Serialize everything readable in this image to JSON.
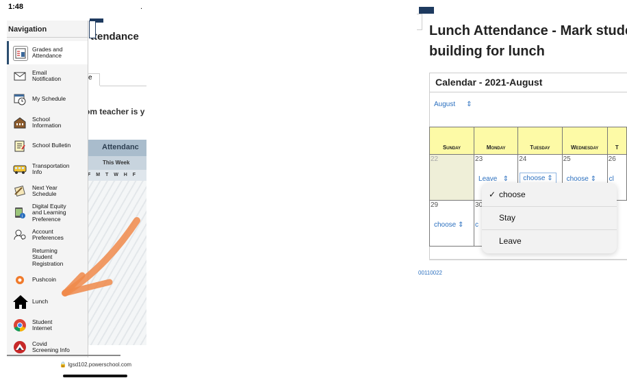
{
  "left_phone": {
    "status_time": "1:48",
    "status_dot": ".",
    "background_page": {
      "title": "ttendance",
      "tab_label": "e",
      "teacher_text": "om teacher is y",
      "table_header": "Attendanc",
      "week_label": "This Week",
      "day_letters": "F M T W H F"
    },
    "navigation": {
      "title": "Navigation",
      "items": [
        {
          "label": "Grades and\nAttendance",
          "icon": "grades-icon",
          "active": true
        },
        {
          "label": "Email\nNotification",
          "icon": "email-icon"
        },
        {
          "label": "My Schedule",
          "icon": "schedule-icon"
        },
        {
          "label": "School\nInformation",
          "icon": "school-icon"
        },
        {
          "label": "School Bulletin",
          "icon": "bulletin-icon"
        },
        {
          "label": "Transportation\nInfo",
          "icon": "bus-icon"
        },
        {
          "label": "Next Year\nSchedule",
          "icon": "next-year-icon"
        },
        {
          "label": "Digital Equity\nand Learning\nPreference",
          "icon": "digital-equity-icon"
        },
        {
          "label": "Account\nPreferences",
          "icon": "account-icon"
        },
        {
          "label": "Returning\nStudent\nRegistration",
          "icon": ""
        },
        {
          "label": "Pushcoin",
          "icon": "pushcoin-icon"
        },
        {
          "label": "Lunch",
          "icon": "home-icon"
        },
        {
          "label": "Student\nInternet",
          "icon": "chrome-icon"
        },
        {
          "label": "Covid\nScreening Info",
          "icon": "covid-icon"
        }
      ]
    },
    "url": "lgsd102.powerschool.com"
  },
  "right_shot": {
    "title": "Lunch Attendance - Mark stude\nbuilding for lunch",
    "calendar_title": "Calendar - 2021-August",
    "month_selected": "August",
    "weekdays": [
      "Sunday",
      "Monday",
      "Tuesday",
      "Wednesday",
      "T"
    ],
    "week1": {
      "days": [
        "22",
        "23",
        "24",
        "25",
        "26"
      ],
      "selects": [
        "",
        "Leave",
        "choose",
        "choose",
        "cl"
      ]
    },
    "week2": {
      "days": [
        "29",
        "30"
      ],
      "selects": [
        "choose",
        "c"
      ]
    },
    "dropdown": {
      "check": "✓",
      "options": [
        "choose",
        "Stay",
        "Leave"
      ]
    },
    "footer": "00110022"
  },
  "colors": {
    "nav_active_border": "#2b4d6f",
    "header_yellow": "#fdfaa6",
    "link_blue": "#2a6fbf",
    "arrow_orange": "#f08a4b"
  }
}
